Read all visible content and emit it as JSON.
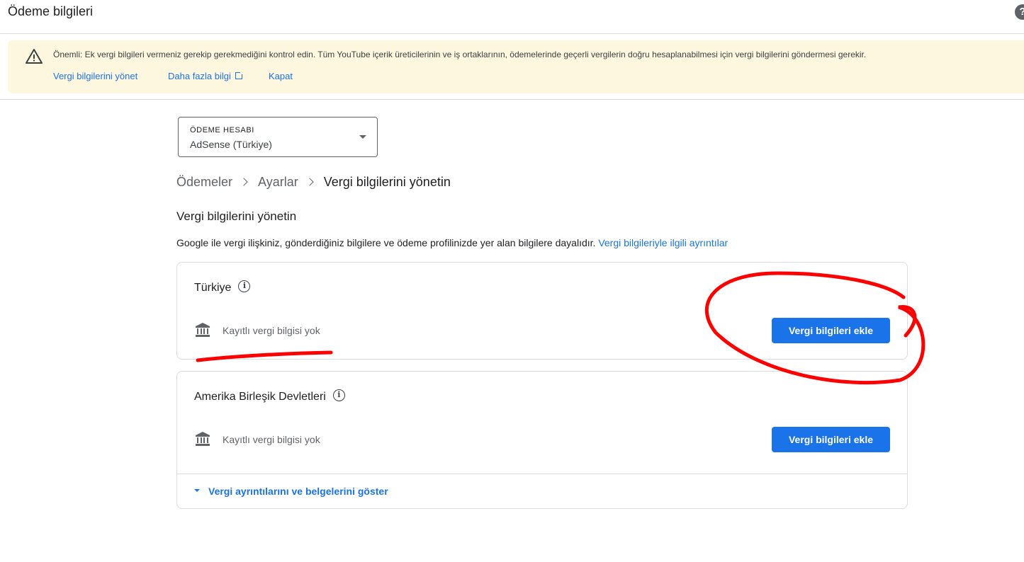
{
  "header": {
    "title": "Ödeme bilgileri",
    "help_icon": "help-icon",
    "help_glyph": "?"
  },
  "banner": {
    "icon": "warning-icon",
    "message": "Önemli: Ek vergi bilgileri vermeniz gerekip gerekmediğini kontrol edin. Tüm YouTube içerik üreticilerinin ve iş ortaklarının, ödemelerinde geçerli vergilerin doğru hesaplanabilmesi için vergi bilgilerini göndermesi gerekir.",
    "link_manage": "Vergi bilgilerini yönet",
    "link_more": "Daha fazla bilgi",
    "link_close": "Kapat",
    "background": "#fef7e0"
  },
  "account": {
    "label": "ÖDEME HESABI",
    "value": "AdSense (Türkiye)"
  },
  "breadcrumb": {
    "items": [
      "Ödemeler",
      "Ayarlar",
      "Vergi bilgilerini yönetin"
    ]
  },
  "section": {
    "title": "Vergi bilgilerini yönetin",
    "description": "Google ile vergi ilişkiniz, gönderdiğiniz bilgilere ve ödeme profilinizde yer alan bilgilere dayalıdır.",
    "link": "Vergi bilgileriyle ilgili ayrıntılar"
  },
  "cards": [
    {
      "country": "Türkiye",
      "info_glyph": "i",
      "status_icon": "bank-icon",
      "status": "Kayıtlı vergi bilgisi yok",
      "button": "Vergi bilgileri ekle"
    },
    {
      "country": "Amerika Birleşik Devletleri",
      "info_glyph": "i",
      "status_icon": "bank-icon",
      "status": "Kayıtlı vergi bilgisi yok",
      "button": "Vergi bilgileri ekle",
      "expand_link": "Vergi ayrıntılarını ve belgelerini göster"
    }
  ],
  "colors": {
    "accent": "#1a73e8",
    "annotation": "#ff0000"
  }
}
